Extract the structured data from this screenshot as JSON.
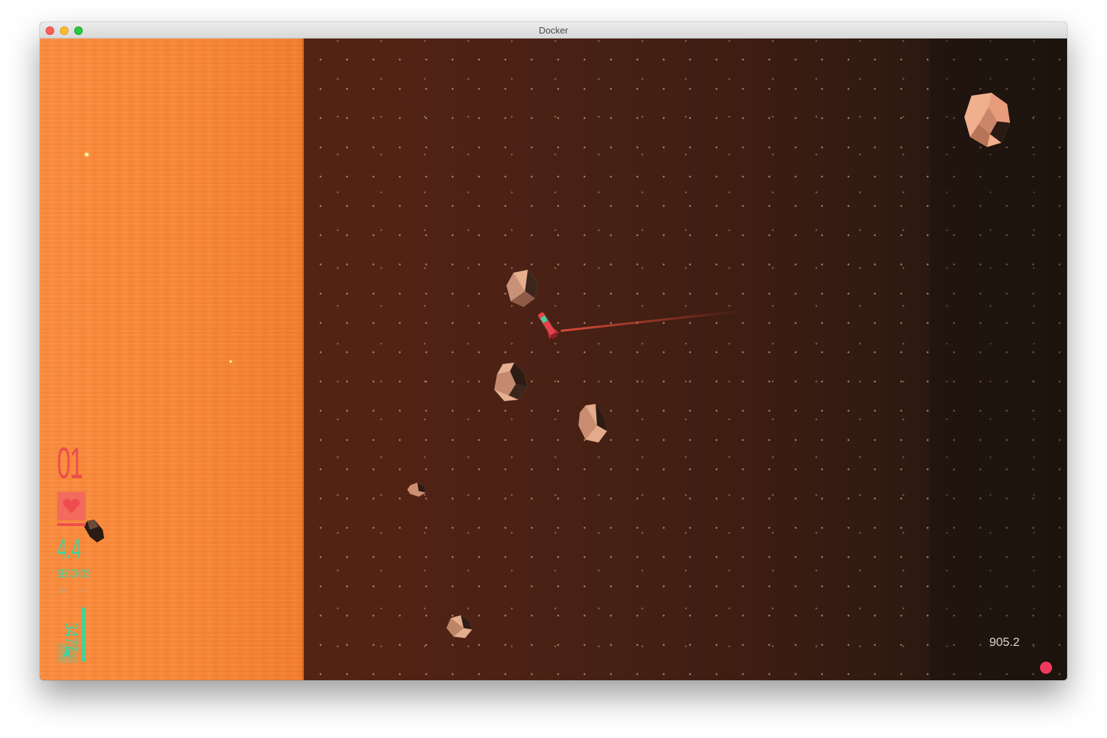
{
  "window": {
    "title": "Docker"
  },
  "hud": {
    "level": "01",
    "lives_icon": "heart-icon",
    "timer_value": "4.4",
    "timer_label": "SECONDS",
    "status_icons": "⚙ ♆",
    "score": "3477",
    "ship_icon": "rocket-icon"
  },
  "fps_readout": "905.2",
  "colors": {
    "sun": "#f6843a",
    "space": "#4c2215",
    "hud_red": "#ee4d4f",
    "hud_green": "#3ed3a0",
    "record_dot": "#f13a5b"
  }
}
